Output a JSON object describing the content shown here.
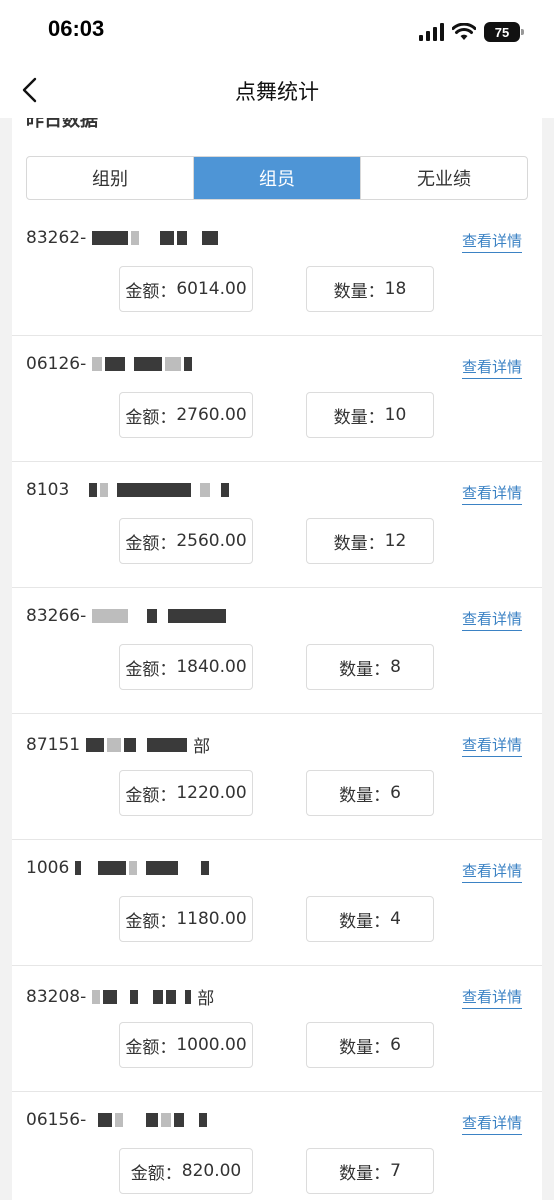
{
  "status_bar": {
    "time": "06:03",
    "battery": "75"
  },
  "nav": {
    "title": "点舞统计"
  },
  "section": {
    "title": "昨日数据"
  },
  "tabs": [
    {
      "label": "组别",
      "active": false
    },
    {
      "label": "组员",
      "active": true
    },
    {
      "label": "无业绩",
      "active": false
    }
  ],
  "detail_label": "查看详情",
  "amount_prefix": "金额：",
  "count_prefix": "数量：",
  "rows": [
    {
      "name": "83262-",
      "suffix": "",
      "amount": "6014.00",
      "count": "18"
    },
    {
      "name": "06126-",
      "suffix": "",
      "amount": "2760.00",
      "count": "10"
    },
    {
      "name": "8103",
      "suffix": "",
      "amount": "2560.00",
      "count": "12"
    },
    {
      "name": "83266-",
      "suffix": "",
      "amount": "1840.00",
      "count": "8"
    },
    {
      "name": "87151",
      "suffix": "部",
      "amount": "1220.00",
      "count": "6"
    },
    {
      "name": "1006",
      "suffix": "",
      "amount": "1180.00",
      "count": "4"
    },
    {
      "name": "83208-",
      "suffix": "部",
      "amount": "1000.00",
      "count": "6"
    },
    {
      "name": "06156-",
      "suffix": "",
      "amount": "820.00",
      "count": "7"
    }
  ]
}
